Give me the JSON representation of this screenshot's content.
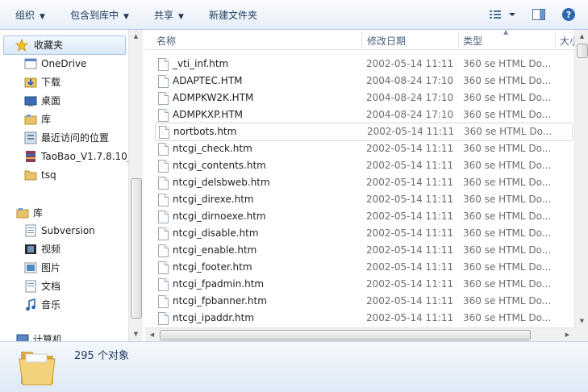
{
  "toolbar": {
    "organize": "组织",
    "include_library": "包含到库中",
    "share": "共享",
    "new_folder": "新建文件夹"
  },
  "nav": {
    "favorites": "收藏夹",
    "favorites_items": [
      "OneDrive",
      "下载",
      "桌面",
      "库",
      "最近访问的位置",
      "TaoBao_V1.7.8.10_",
      "tsq"
    ],
    "libraries": "库",
    "library_items": [
      "Subversion",
      "视频",
      "图片",
      "文档",
      "音乐"
    ],
    "computer": "计算机"
  },
  "columns": {
    "name": "名称",
    "date": "修改日期",
    "type": "类型",
    "size": "大小"
  },
  "files": [
    {
      "name": "_vti_inf.htm",
      "date": "2002-05-14 11:11",
      "type": "360 se HTML Do..."
    },
    {
      "name": "ADAPTEC.HTM",
      "date": "2004-08-24 17:10",
      "type": "360 se HTML Do..."
    },
    {
      "name": "ADMPKW2K.HTM",
      "date": "2004-08-24 17:10",
      "type": "360 se HTML Do..."
    },
    {
      "name": "ADMPKXP.HTM",
      "date": "2004-08-24 17:10",
      "type": "360 se HTML Do..."
    },
    {
      "name": "nortbots.htm",
      "date": "2002-05-14 11:11",
      "type": "360 se HTML Do..."
    },
    {
      "name": "ntcgi_check.htm",
      "date": "2002-05-14 11:11",
      "type": "360 se HTML Do..."
    },
    {
      "name": "ntcgi_contents.htm",
      "date": "2002-05-14 11:11",
      "type": "360 se HTML Do..."
    },
    {
      "name": "ntcgi_delsbweb.htm",
      "date": "2002-05-14 11:11",
      "type": "360 se HTML Do..."
    },
    {
      "name": "ntcgi_direxe.htm",
      "date": "2002-05-14 11:11",
      "type": "360 se HTML Do..."
    },
    {
      "name": "ntcgi_dirnoexe.htm",
      "date": "2002-05-14 11:11",
      "type": "360 se HTML Do..."
    },
    {
      "name": "ntcgi_disable.htm",
      "date": "2002-05-14 11:11",
      "type": "360 se HTML Do..."
    },
    {
      "name": "ntcgi_enable.htm",
      "date": "2002-05-14 11:11",
      "type": "360 se HTML Do..."
    },
    {
      "name": "ntcgi_footer.htm",
      "date": "2002-05-14 11:11",
      "type": "360 se HTML Do..."
    },
    {
      "name": "ntcgi_fpadmin.htm",
      "date": "2002-05-14 11:11",
      "type": "360 se HTML Do..."
    },
    {
      "name": "ntcgi_fpbanner.htm",
      "date": "2002-05-14 11:11",
      "type": "360 se HTML Do..."
    },
    {
      "name": "ntcgi_ipaddr.htm",
      "date": "2002-05-14 11:11",
      "type": "360 se HTML Do..."
    }
  ],
  "details": {
    "count": "295 个对象"
  },
  "colors": {
    "toolbar_text": "#1e395b",
    "accent": "#2a67b1"
  }
}
